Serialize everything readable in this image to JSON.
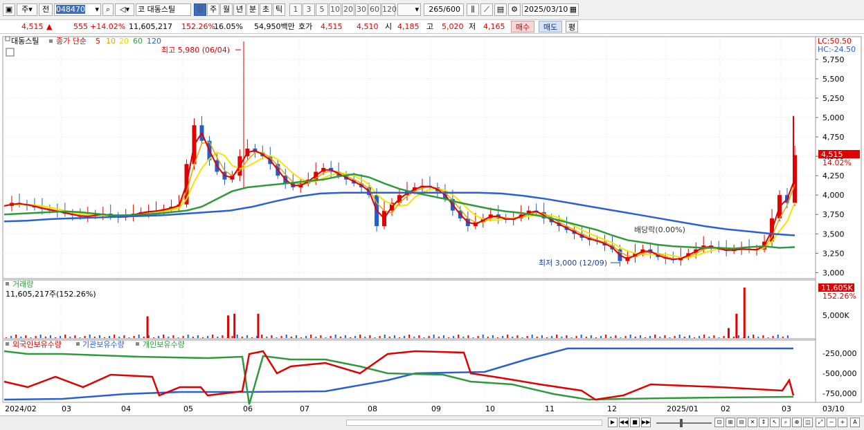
{
  "toolbar": {
    "market_type": "주",
    "prev": "전",
    "stock_code": "048470",
    "stock_prefix": "코",
    "stock_name": "대동스틸",
    "periods": [
      "일",
      "주",
      "월",
      "년",
      "분",
      "초",
      "틱"
    ],
    "minutes": [
      "1",
      "3",
      "5",
      "10",
      "20",
      "30",
      "60",
      "120"
    ],
    "selected_period": "일",
    "count_current": "265",
    "count_total": "/600",
    "date": "2025/03/10"
  },
  "quote": {
    "price": "4,515",
    "change_arrow": "▲",
    "change": "555",
    "change_pct": "+14.02%",
    "volume": "11,605,217",
    "volume_ratio": "152.26%",
    "turnover": "16.05%",
    "amount": "54,950백만",
    "hoga_label": "호가",
    "ask": "4,515",
    "bid": "4,510",
    "open_label": "시",
    "open": "4,185",
    "high_label": "고",
    "high": "5,020",
    "low_label": "저",
    "low": "4,165",
    "buy_label": "매수",
    "sell_label": "매도",
    "eval_label": "평"
  },
  "legend": {
    "name": "대동스틸",
    "ma_title": "종가 단순",
    "ma5": "5",
    "ma10": "10",
    "ma20": "20",
    "ma60": "60",
    "ma120": "120"
  },
  "colors": {
    "ma5": "#e00000",
    "ma10": "#f0a000",
    "ma20": "#f2e600",
    "ma60": "#2e9a3c",
    "ma120": "#2a5fd6",
    "up": "#e00000",
    "down": "#1f5fcf"
  },
  "annotations": {
    "high": "최고 5,980 (06/04)",
    "low": "최저 3,000 (12/09)",
    "dividend": "배당락(0.00%)"
  },
  "right_panel": {
    "lc": "LC:50.50",
    "hc": "HC:-24.50",
    "price_tag": "4,515",
    "pct_tag": "14.02%"
  },
  "price_axis": [
    "5,750",
    "5,500",
    "5,250",
    "5,000",
    "4,750",
    "4,500",
    "4,250",
    "4,000",
    "3,750",
    "3,500",
    "3,250",
    "3,000"
  ],
  "volume_panel": {
    "title": "거래량",
    "value": "11,605,217주(152.26%)",
    "tag": "11,605K",
    "tag_pct": "152.26%",
    "axis": [
      "5,000K"
    ]
  },
  "holdings_panel": {
    "foreign": "외국인보유수량",
    "inst": "기관보유수량",
    "indiv": "개인보유수량",
    "axis": [
      "-250,000",
      "-500,000",
      "-750,000"
    ]
  },
  "date_axis": [
    "2024/02",
    "03",
    "04",
    "05",
    "06",
    "07",
    "08",
    "09",
    "10",
    "11",
    "12",
    "2025/01",
    "02",
    "03"
  ],
  "date_axis_end": "03/10",
  "chart_data": {
    "type": "candlestick",
    "price_range": [
      2950,
      5980
    ],
    "close_series": [
      3860,
      3900,
      3880,
      3870,
      3840,
      3820,
      3800,
      3780,
      3760,
      3740,
      3720,
      3730,
      3750,
      3760,
      3720,
      3710,
      3730,
      3760,
      3780,
      3790,
      3800,
      3820,
      3850,
      3880,
      4400,
      4900,
      4700,
      4450,
      4300,
      4200,
      4250,
      4500,
      4600,
      4550,
      4500,
      4400,
      4250,
      4150,
      4100,
      4150,
      4200,
      4300,
      4350,
      4300,
      4250,
      4200,
      4150,
      4100,
      4000,
      3600,
      3800,
      3900,
      4000,
      4050,
      4100,
      4120,
      4100,
      4050,
      3950,
      3800,
      3700,
      3600,
      3650,
      3700,
      3750,
      3700,
      3680,
      3700,
      3750,
      3800,
      3780,
      3700,
      3650,
      3600,
      3550,
      3500,
      3450,
      3420,
      3400,
      3350,
      3300,
      3150,
      3200,
      3250,
      3300,
      3250,
      3200,
      3180,
      3160,
      3200,
      3250,
      3300,
      3350,
      3320,
      3300,
      3280,
      3300,
      3310,
      3290,
      3300,
      3400,
      3700,
      4000,
      3900,
      4515
    ],
    "ma60": [
      3750,
      3760,
      3770,
      3780,
      3790,
      3780,
      3760,
      3740,
      3740,
      3750,
      3760,
      3780,
      3800,
      3850,
      3950,
      4050,
      4100,
      4120,
      4140,
      4160,
      4180,
      4200,
      4240,
      4270,
      4230,
      4150,
      4080,
      4030,
      3990,
      3950,
      3900,
      3860,
      3820,
      3790,
      3770,
      3740,
      3700,
      3650,
      3600,
      3550,
      3480,
      3420,
      3390,
      3360,
      3340,
      3330,
      3320,
      3320,
      3310,
      3330,
      3340,
      3320,
      3330
    ],
    "ma120": [
      3660,
      3670,
      3690,
      3700,
      3710,
      3720,
      3730,
      3740,
      3760,
      3780,
      3800,
      3850,
      3920,
      3980,
      4020,
      4030,
      4030,
      4030,
      4030,
      4030,
      4030,
      4030,
      4020,
      3990,
      3950,
      3900,
      3850,
      3800,
      3750,
      3700,
      3650,
      3600,
      3560,
      3530,
      3500,
      3480
    ],
    "volume_spikes": [
      {
        "month_pos": 0.18,
        "volume_k": 5000
      },
      {
        "month_pos": 0.282,
        "volume_k": 5200
      },
      {
        "month_pos": 0.29,
        "volume_k": 5600
      },
      {
        "month_pos": 0.32,
        "volume_k": 5600
      },
      {
        "month_pos": 0.915,
        "volume_k": 2300
      },
      {
        "month_pos": 0.925,
        "volume_k": 5600
      },
      {
        "month_pos": 0.935,
        "volume_k": 11605
      }
    ]
  }
}
